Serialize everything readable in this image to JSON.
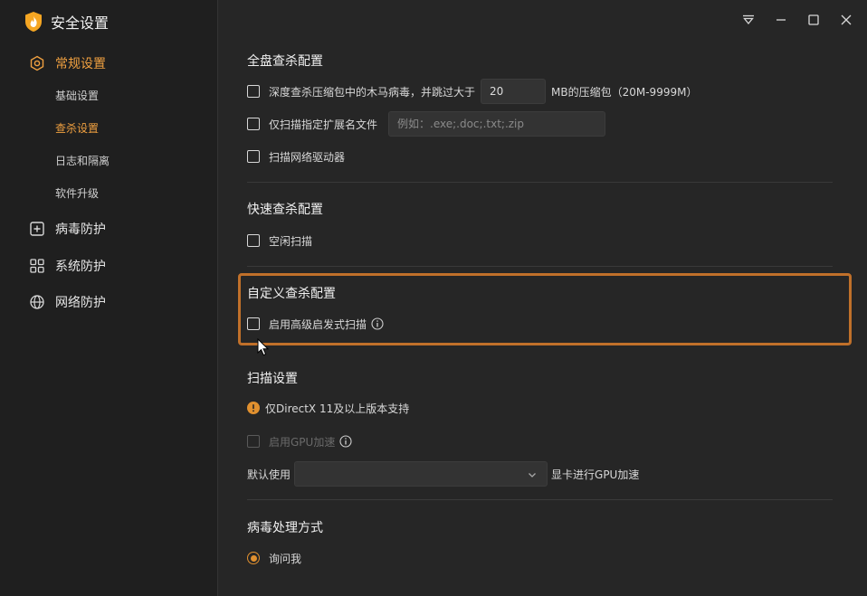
{
  "app": {
    "title": "安全设置"
  },
  "sidebar": {
    "items": [
      {
        "label": "常规设置",
        "icon": "settings-icon",
        "active": true
      },
      {
        "label": "病毒防护",
        "icon": "plus-square-icon"
      },
      {
        "label": "系统防护",
        "icon": "grid-icon"
      },
      {
        "label": "网络防护",
        "icon": "globe-icon"
      }
    ],
    "sub_items": [
      {
        "label": "基础设置"
      },
      {
        "label": "查杀设置",
        "active": true
      },
      {
        "label": "日志和隔离"
      },
      {
        "label": "软件升级"
      }
    ]
  },
  "full_scan": {
    "title": "全盘查杀配置",
    "deep_scan_label": "深度查杀压缩包中的木马病毒，并跳过大于",
    "deep_scan_value": "20",
    "deep_scan_suffix": "MB的压缩包（20M-9999M）",
    "ext_only_label": "仅扫描指定扩展名文件",
    "ext_placeholder": "例如：.exe;.doc;.txt;.zip",
    "network_drive_label": "扫描网络驱动器"
  },
  "quick_scan": {
    "title": "快速查杀配置",
    "idle_scan_label": "空闲扫描"
  },
  "custom_scan": {
    "title": "自定义查杀配置",
    "heuristic_label": "启用高级启发式扫描"
  },
  "scan_settings": {
    "title": "扫描设置",
    "warning": "仅DirectX 11及以上版本支持",
    "gpu_label": "启用GPU加速",
    "default_use_label": "默认使用",
    "gpu_select_value": "",
    "gpu_suffix": "显卡进行GPU加速"
  },
  "virus_handling": {
    "title": "病毒处理方式",
    "ask_me_label": "询问我"
  },
  "colors": {
    "accent": "#f0a040",
    "highlight_border": "#c0702a",
    "warning": "#e0902f"
  }
}
